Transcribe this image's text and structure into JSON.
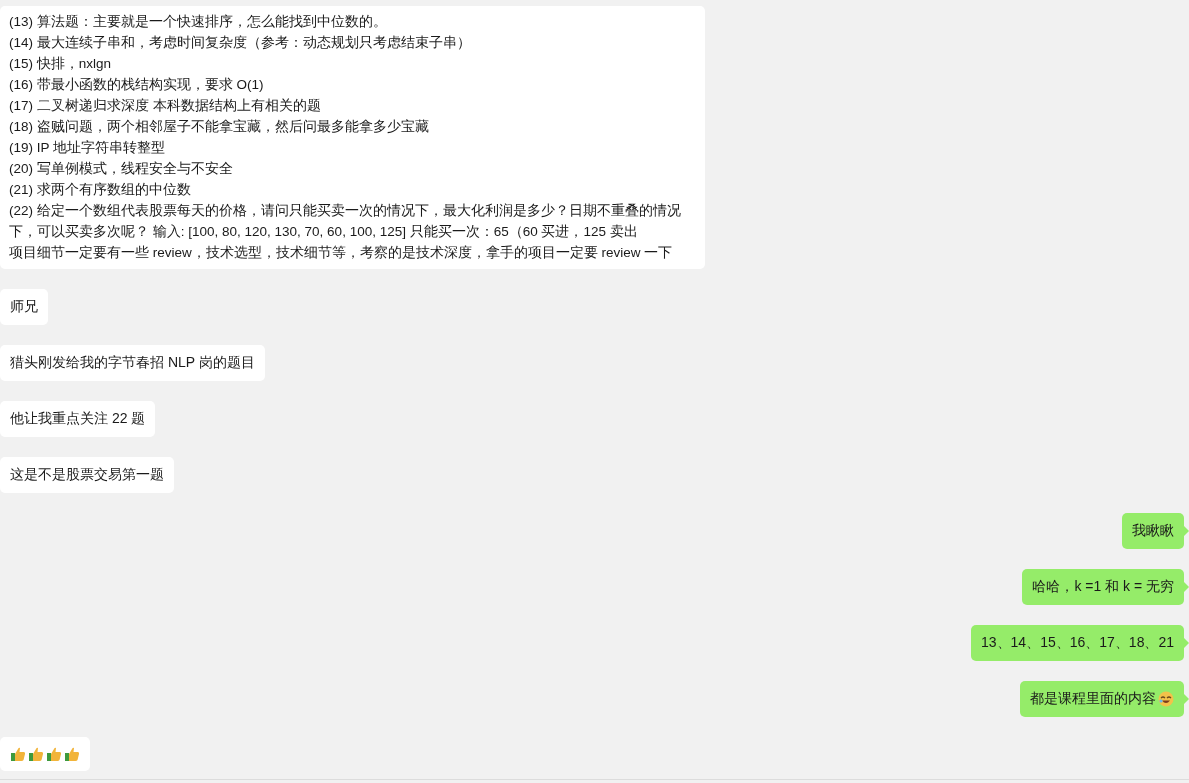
{
  "messages": [
    {
      "outgoing": false,
      "kind": "lines",
      "lines": [
        "(13) 算法题：主要就是一个快速排序，怎么能找到中位数的。",
        "(14) 最大连续子串和，考虑时间复杂度（参考：动态规划只考虑结束子串）",
        "(15) 快排，nxlgn",
        "(16) 带最小函数的栈结构实现，要求 O(1)",
        "(17) 二叉树递归求深度 本科数据结构上有相关的题",
        "(18) 盗贼问题，两个相邻屋子不能拿宝藏，然后问最多能拿多少宝藏",
        "(19) IP 地址字符串转整型",
        "(20) 写单例模式，线程安全与不安全",
        "(21) 求两个有序数组的中位数",
        "(22) 给定一个数组代表股票每天的价格，请问只能买卖一次的情况下，最大化利润是多少？日期不重叠的情况",
        "下，可以买卖多次呢？ 输入: [100, 80, 120, 130, 70, 60, 100, 125] 只能买一次：65（60 买进，125 卖出",
        "项目细节一定要有一些 review，技术选型，技术细节等，考察的是技术深度，拿手的项目一定要 review 一下"
      ]
    },
    {
      "outgoing": false,
      "kind": "text",
      "text": "师兄"
    },
    {
      "outgoing": false,
      "kind": "text",
      "text": "猎头刚发给我的字节春招 NLP 岗的题目"
    },
    {
      "outgoing": false,
      "kind": "text",
      "text": "他让我重点关注 22 题"
    },
    {
      "outgoing": false,
      "kind": "text",
      "text": "这是不是股票交易第一题"
    },
    {
      "outgoing": true,
      "kind": "text",
      "text": "我瞅瞅"
    },
    {
      "outgoing": true,
      "kind": "text",
      "text": "哈哈，k =1 和 k = 无穷"
    },
    {
      "outgoing": true,
      "kind": "text",
      "text": "13、14、15、16、17、18、21"
    },
    {
      "outgoing": true,
      "kind": "text",
      "text": "都是课程里面的内容",
      "trailing_emoji": true
    },
    {
      "outgoing": false,
      "kind": "thumbs"
    }
  ]
}
